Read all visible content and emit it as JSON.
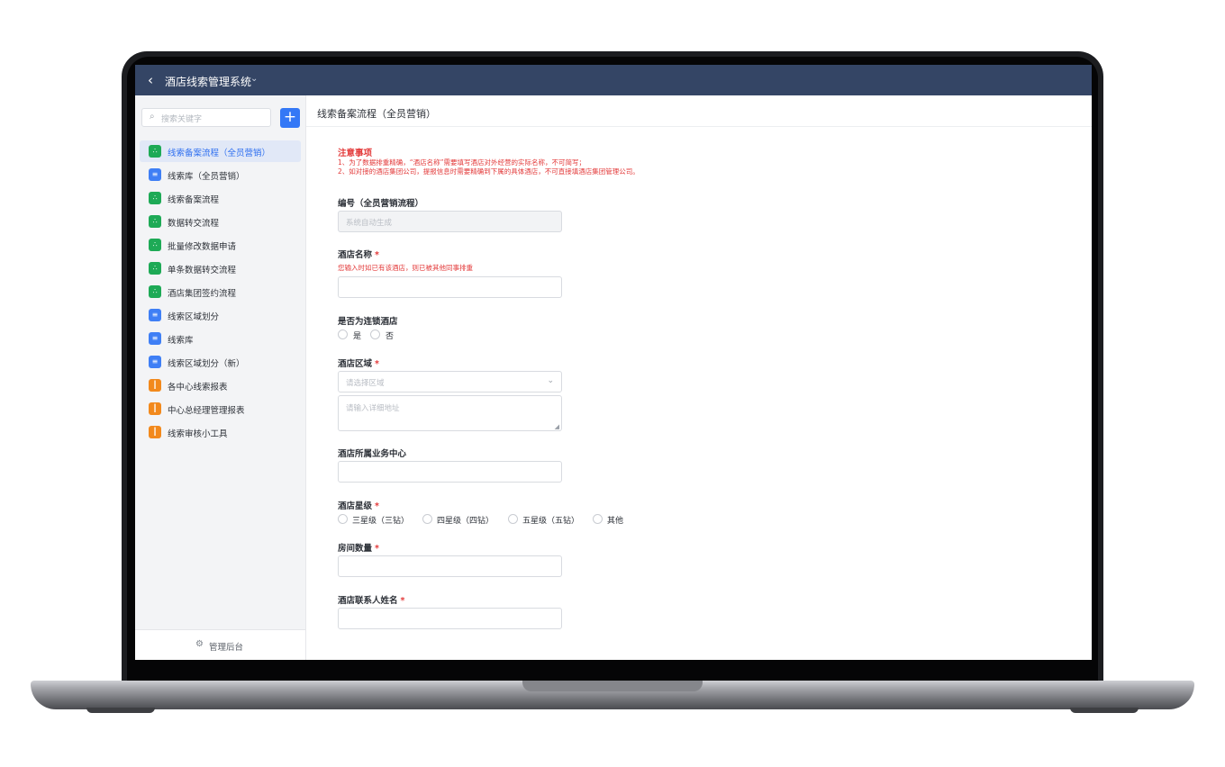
{
  "app": {
    "title": "酒店线索管理系统"
  },
  "sidebar": {
    "search_placeholder": "搜索关键字",
    "add_label": "+",
    "items": [
      {
        "label": "线索备案流程（全员营销）",
        "icon": "flow-icon",
        "color": "#1eaa56",
        "active": true
      },
      {
        "label": "线索库（全员营销）",
        "icon": "document-icon",
        "color": "#3f7ff5"
      },
      {
        "label": "线索备案流程",
        "icon": "flow-icon",
        "color": "#1eaa56"
      },
      {
        "label": "数据转交流程",
        "icon": "flow-icon",
        "color": "#1eaa56"
      },
      {
        "label": "批量修改数据申请",
        "icon": "flow-icon",
        "color": "#1eaa56"
      },
      {
        "label": "单条数据转交流程",
        "icon": "flow-icon",
        "color": "#1eaa56"
      },
      {
        "label": "酒店集团签约流程",
        "icon": "flow-icon",
        "color": "#1eaa56"
      },
      {
        "label": "线索区域划分",
        "icon": "document-icon",
        "color": "#3f7ff5"
      },
      {
        "label": "线索库",
        "icon": "document-icon",
        "color": "#3f7ff5"
      },
      {
        "label": "线索区域划分（新）",
        "icon": "document-icon",
        "color": "#3f7ff5"
      },
      {
        "label": "各中心线索报表",
        "icon": "report-icon",
        "color": "#f2891c"
      },
      {
        "label": "中心总经理管理报表",
        "icon": "report-icon",
        "color": "#f2891c"
      },
      {
        "label": "线索审核小工具",
        "icon": "report-icon",
        "color": "#f2891c"
      }
    ],
    "footer_label": "管理后台"
  },
  "page": {
    "title": "线索备案流程（全员营销）",
    "notice": {
      "title": "注意事项",
      "line1": "1、为了数据排重精确，“酒店名称”需要填写酒店对外经营的实际名称，不可简写；",
      "line2": "2、如对接的酒店集团公司，提报信息时需要精确到下属的具体酒店，不可直接填酒店集团管理公司。"
    },
    "fields": {
      "number": {
        "label": "编号（全员营销流程）",
        "placeholder": "系统自动生成"
      },
      "hotel_name": {
        "label": "酒店名称",
        "required": "*",
        "hint": "您输入时如已有该酒店，则已被其他同事排重"
      },
      "is_chain": {
        "label": "是否为连锁酒店",
        "options": [
          "是",
          "否"
        ]
      },
      "region": {
        "label": "酒店区域",
        "required": "*",
        "placeholder": "请选择区域",
        "address_placeholder": "请输入详细地址"
      },
      "business_center": {
        "label": "酒店所属业务中心"
      },
      "star_level": {
        "label": "酒店星级",
        "required": "*",
        "options": [
          "三星级（三钻）",
          "四星级（四钻）",
          "五星级（五钻）",
          "其他"
        ]
      },
      "room_count": {
        "label": "房间数量",
        "required": "*"
      },
      "contact_name": {
        "label": "酒店联系人姓名",
        "required": "*"
      }
    }
  }
}
